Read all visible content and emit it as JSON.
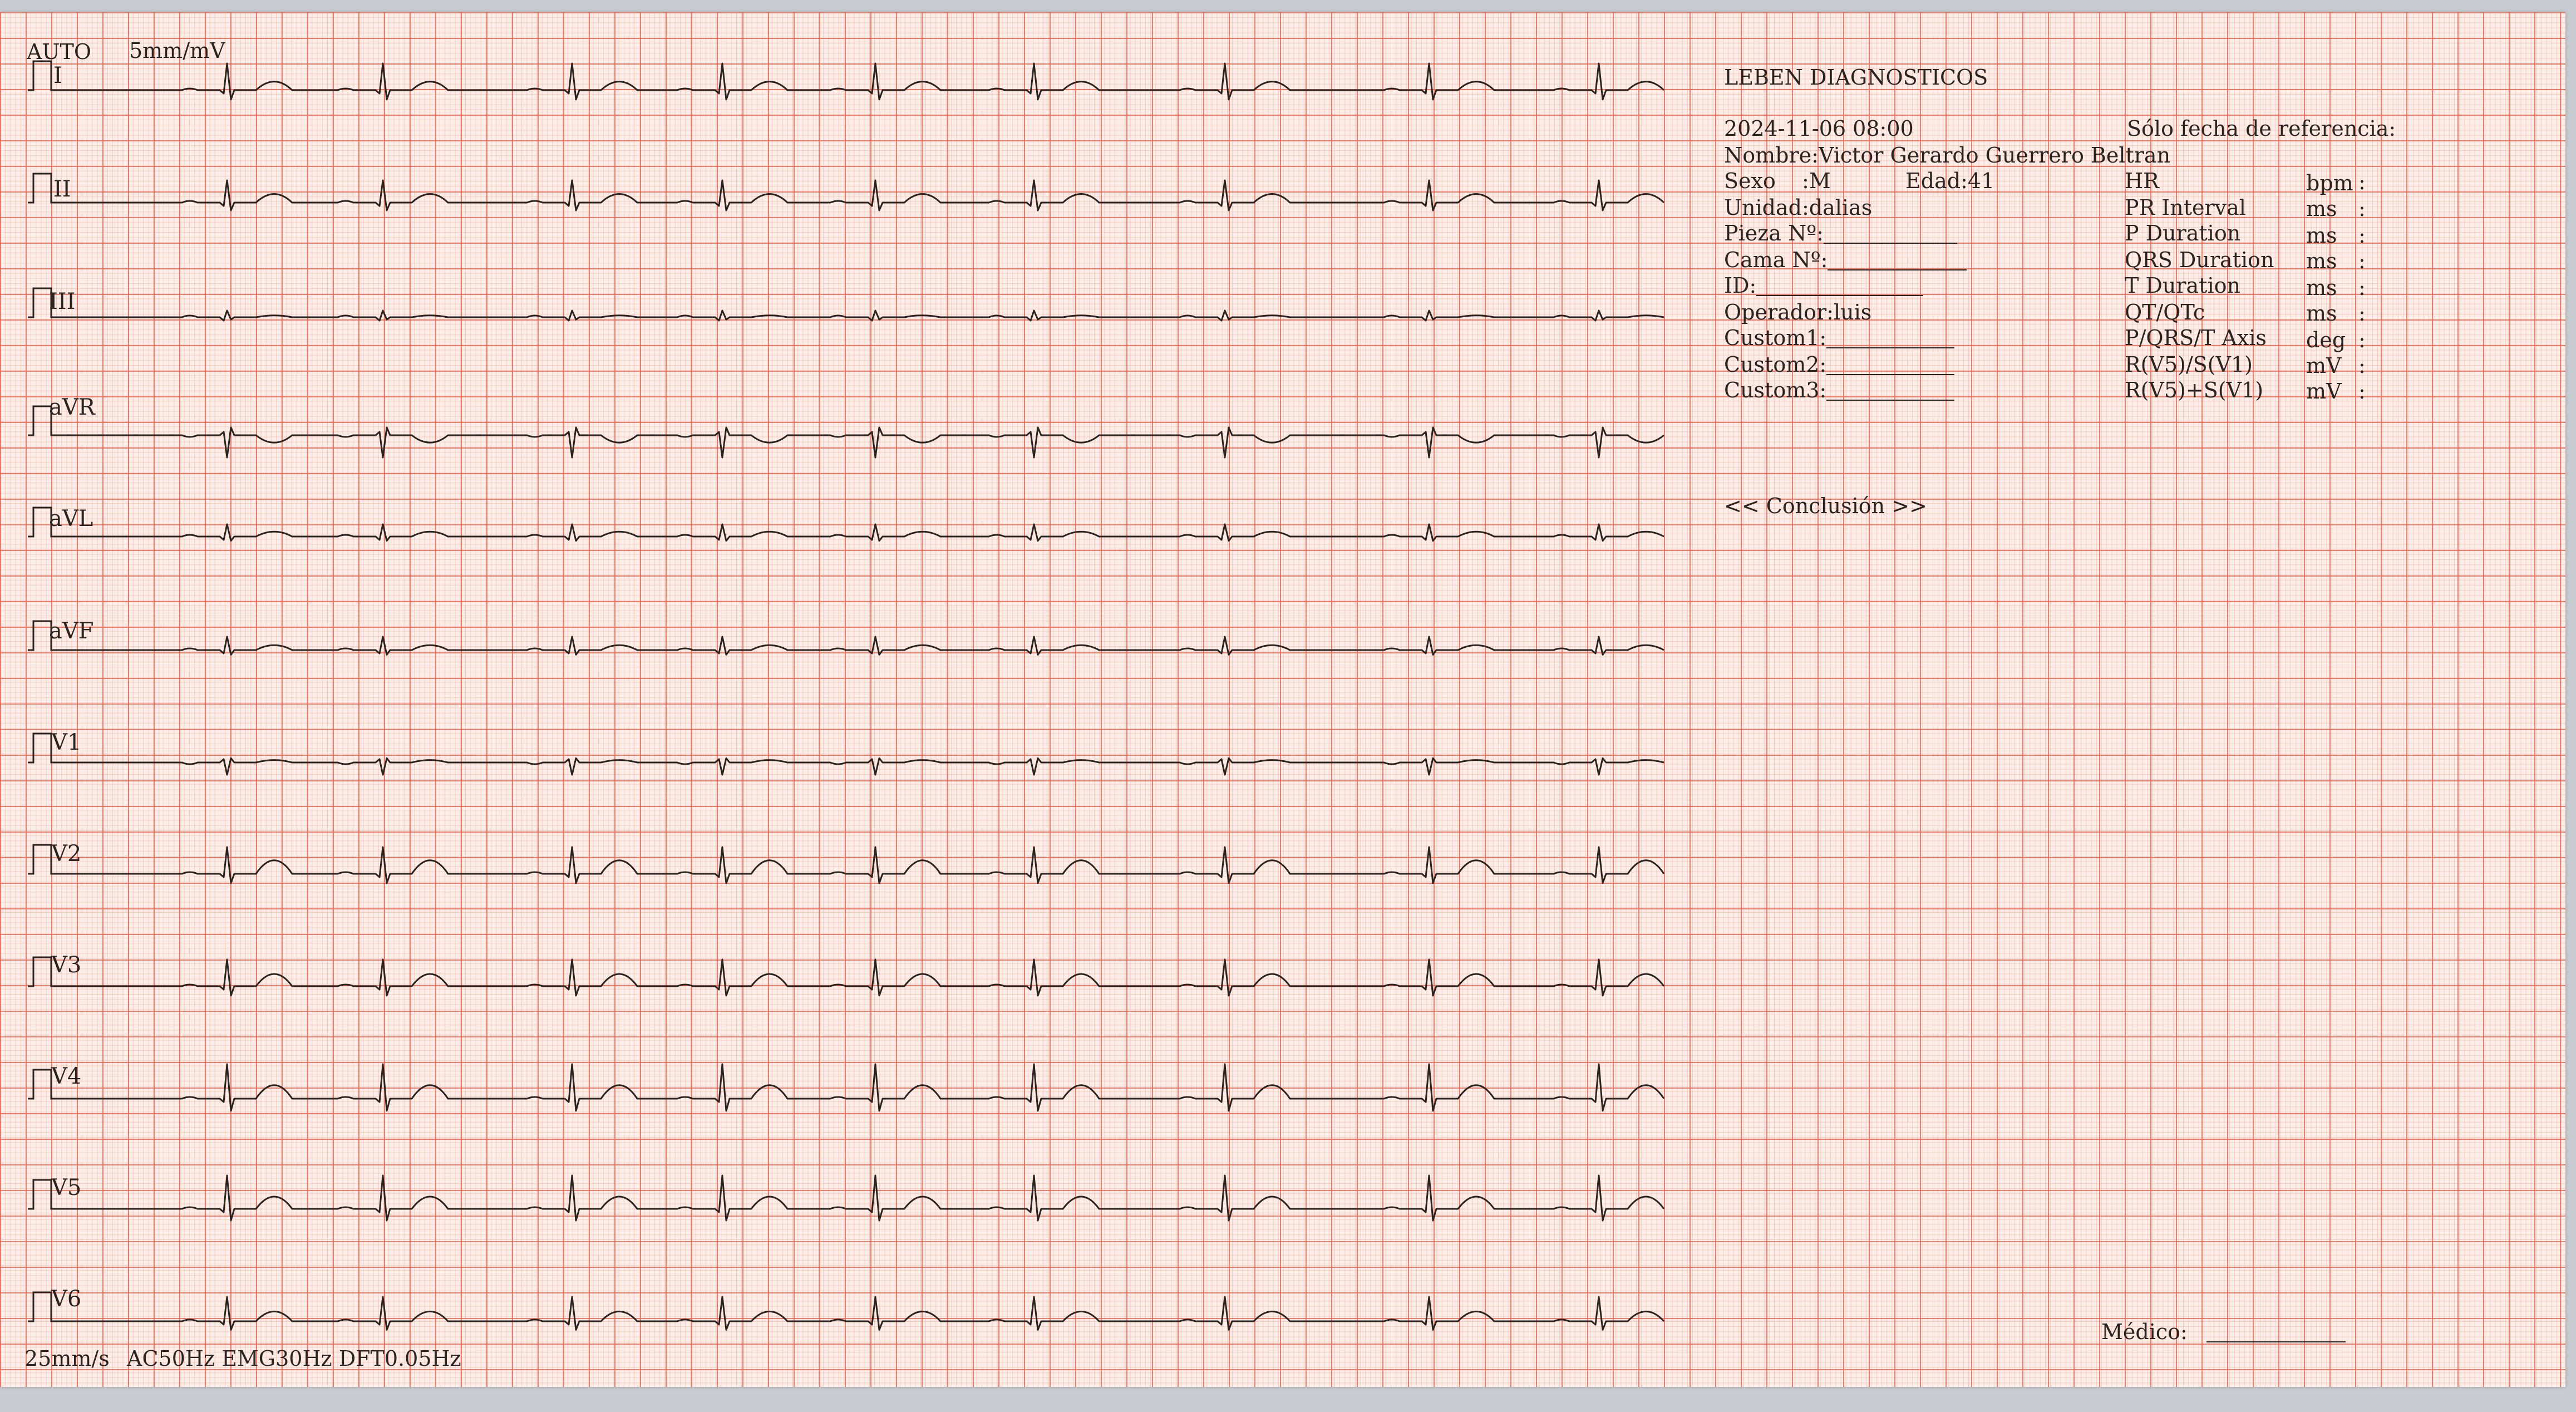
{
  "header": {
    "mode": "AUTO",
    "gain": "5mm/mV"
  },
  "leads": [
    "I",
    "II",
    "III",
    "aVR",
    "aVL",
    "aVF",
    "V1",
    "V2",
    "V3",
    "V4",
    "V5",
    "V6"
  ],
  "footer": {
    "speed": "25mm/s",
    "filters": "AC50Hz EMG30Hz DFT0.05Hz"
  },
  "report": {
    "clinic": "LEBEN DIAGNOSTICOS",
    "datetime": "2024-11-06 08:00",
    "reference_note": "Sólo fecha de referencia:",
    "name_line": "Nombre:Victor Gerardo Guerrero Beltran",
    "sex_label": "Sexo",
    "sex_value": ":M",
    "age": "Edad:41",
    "unit": "Unidad:dalias",
    "room": "Pieza Nº:",
    "bed": "Cama Nº:",
    "id": "ID:",
    "operator": "Operador:luis",
    "custom1": "Custom1:",
    "custom2": "Custom2:",
    "custom3": "Custom3:",
    "measurements": [
      {
        "name": "HR",
        "unit": "bpm",
        "sep": ":"
      },
      {
        "name": "PR Interval",
        "unit": "ms",
        "sep": ":"
      },
      {
        "name": "P Duration",
        "unit": "ms",
        "sep": ":"
      },
      {
        "name": "QRS Duration",
        "unit": "ms",
        "sep": ":"
      },
      {
        "name": "T Duration",
        "unit": "ms",
        "sep": ":"
      },
      {
        "name": "QT/QTc",
        "unit": "ms",
        "sep": ":"
      },
      {
        "name": "P/QRS/T Axis",
        "unit": "deg",
        "sep": ":"
      },
      {
        "name": "R(V5)/S(V1)",
        "unit": "mV",
        "sep": ":"
      },
      {
        "name": "R(V5)+S(V1)",
        "unit": "mV",
        "sep": ":"
      }
    ],
    "conclusion": "<< Conclusión >>",
    "doctor": "Médico:"
  },
  "colors": {
    "grid_major": "#e85a46",
    "grid_minor": "#ee8c78",
    "paper": "#fbeee8",
    "trace": "#2a2320"
  }
}
